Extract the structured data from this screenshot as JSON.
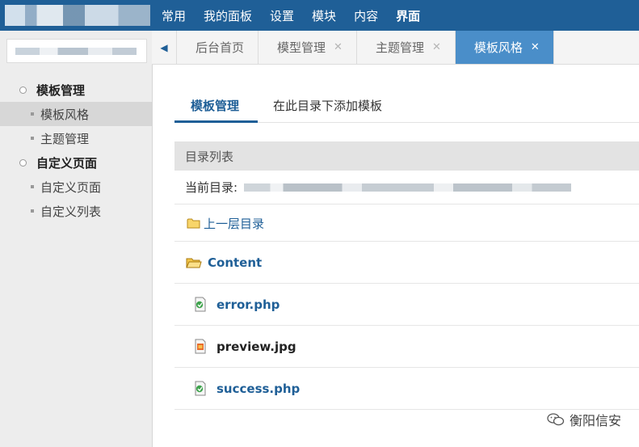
{
  "topnav": {
    "items": [
      {
        "label": "常用"
      },
      {
        "label": "我的面板"
      },
      {
        "label": "设置"
      },
      {
        "label": "模块"
      },
      {
        "label": "内容"
      },
      {
        "label": "界面"
      }
    ],
    "active_index": 5
  },
  "sidebar": {
    "groups": [
      {
        "title": "模板管理",
        "items": [
          "模板风格",
          "主题管理"
        ]
      },
      {
        "title": "自定义页面",
        "items": [
          "自定义页面",
          "自定义列表"
        ]
      }
    ],
    "active_item": "模板风格"
  },
  "tabs": {
    "items": [
      {
        "label": "后台首页",
        "closable": false
      },
      {
        "label": "模型管理",
        "closable": true
      },
      {
        "label": "主题管理",
        "closable": true
      },
      {
        "label": "模板风格",
        "closable": true
      }
    ],
    "active_index": 3,
    "close_glyph": "✕",
    "prev_glyph": "◀"
  },
  "subtabs": {
    "items": [
      "模板管理",
      "在此目录下添加模板"
    ],
    "active_index": 0
  },
  "directory": {
    "header": "目录列表",
    "current_label": "当前目录:"
  },
  "files": [
    {
      "name": "上一层目录",
      "icon": "folder-icon",
      "kind": "up"
    },
    {
      "name": "Content",
      "icon": "folder-open-icon",
      "kind": "folder"
    },
    {
      "name": "error.php",
      "icon": "php-file-icon",
      "kind": "file"
    },
    {
      "name": "preview.jpg",
      "icon": "image-file-icon",
      "kind": "file"
    },
    {
      "name": "success.php",
      "icon": "php-file-icon",
      "kind": "file"
    }
  ],
  "watermark": {
    "text": "衡阳信安"
  },
  "colors": {
    "topbar": "#1f5f97",
    "accent": "#4a8ec9",
    "link": "#1f5f97"
  }
}
